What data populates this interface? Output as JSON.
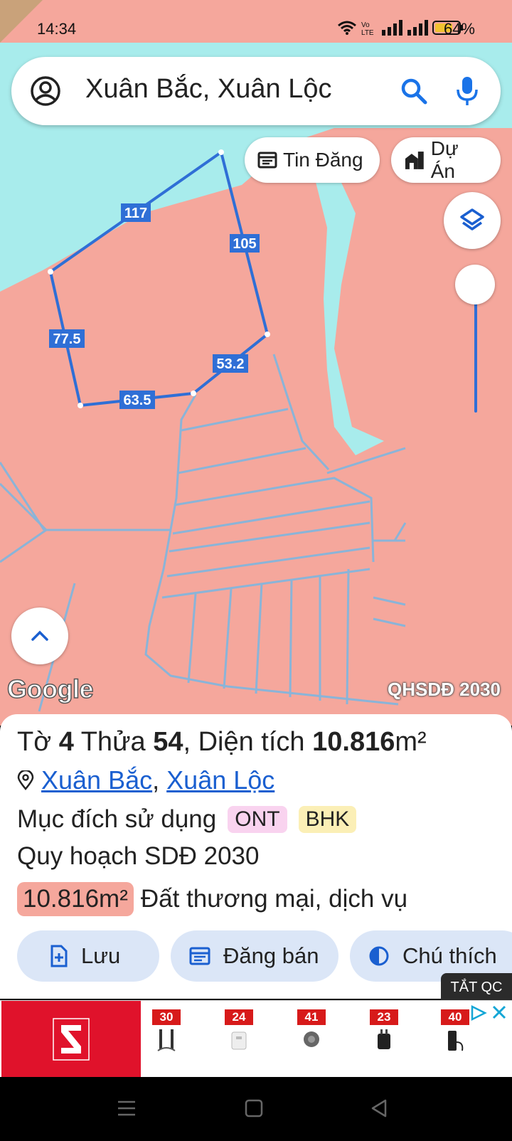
{
  "status_bar": {
    "time": "14:34",
    "battery_label": "64%",
    "icons": [
      "wifi-icon",
      "volte-icon",
      "signal-icon",
      "signal-icon",
      "battery-icon"
    ]
  },
  "search": {
    "query": "Xuân Bắc, Xuân Lộc"
  },
  "map": {
    "chips": {
      "tin_dang": "Tin Đăng",
      "du_an": "Dự Án"
    },
    "edge_labels": [
      "117",
      "105",
      "53.2",
      "63.5",
      "77.5"
    ],
    "watermark": "Google",
    "layer_label": "QHSDĐ 2030",
    "colors": {
      "land": "#f5a79c",
      "water": "#a8ecec",
      "parcel_line": "#2f6fd6",
      "boundary": "#8ab4d8"
    }
  },
  "panel": {
    "to_label": "Tờ",
    "to_value": "4",
    "thua_label": "Thửa",
    "thua_value": "54",
    "dientich_label": ", Diện tích",
    "dientich_value": "10.816",
    "dientich_unit": "m²",
    "location_commune": "Xuân Bắc",
    "location_sep": ",",
    "location_district": "Xuân Lộc",
    "purpose_label": "Mục đích sử dụng",
    "purpose_tags": [
      "ONT",
      "BHK"
    ],
    "plan_label": "Quy hoạch SDĐ 2030",
    "plan_area": "10.816m²",
    "plan_use": "Đất thương mại, dịch vụ",
    "buttons": {
      "save": "Lưu",
      "sell": "Đăng bán",
      "legend": "Chú thích"
    }
  },
  "ad": {
    "hide_label": "TẮT QC",
    "items": [
      "30",
      "24",
      "41",
      "23",
      "40"
    ]
  }
}
